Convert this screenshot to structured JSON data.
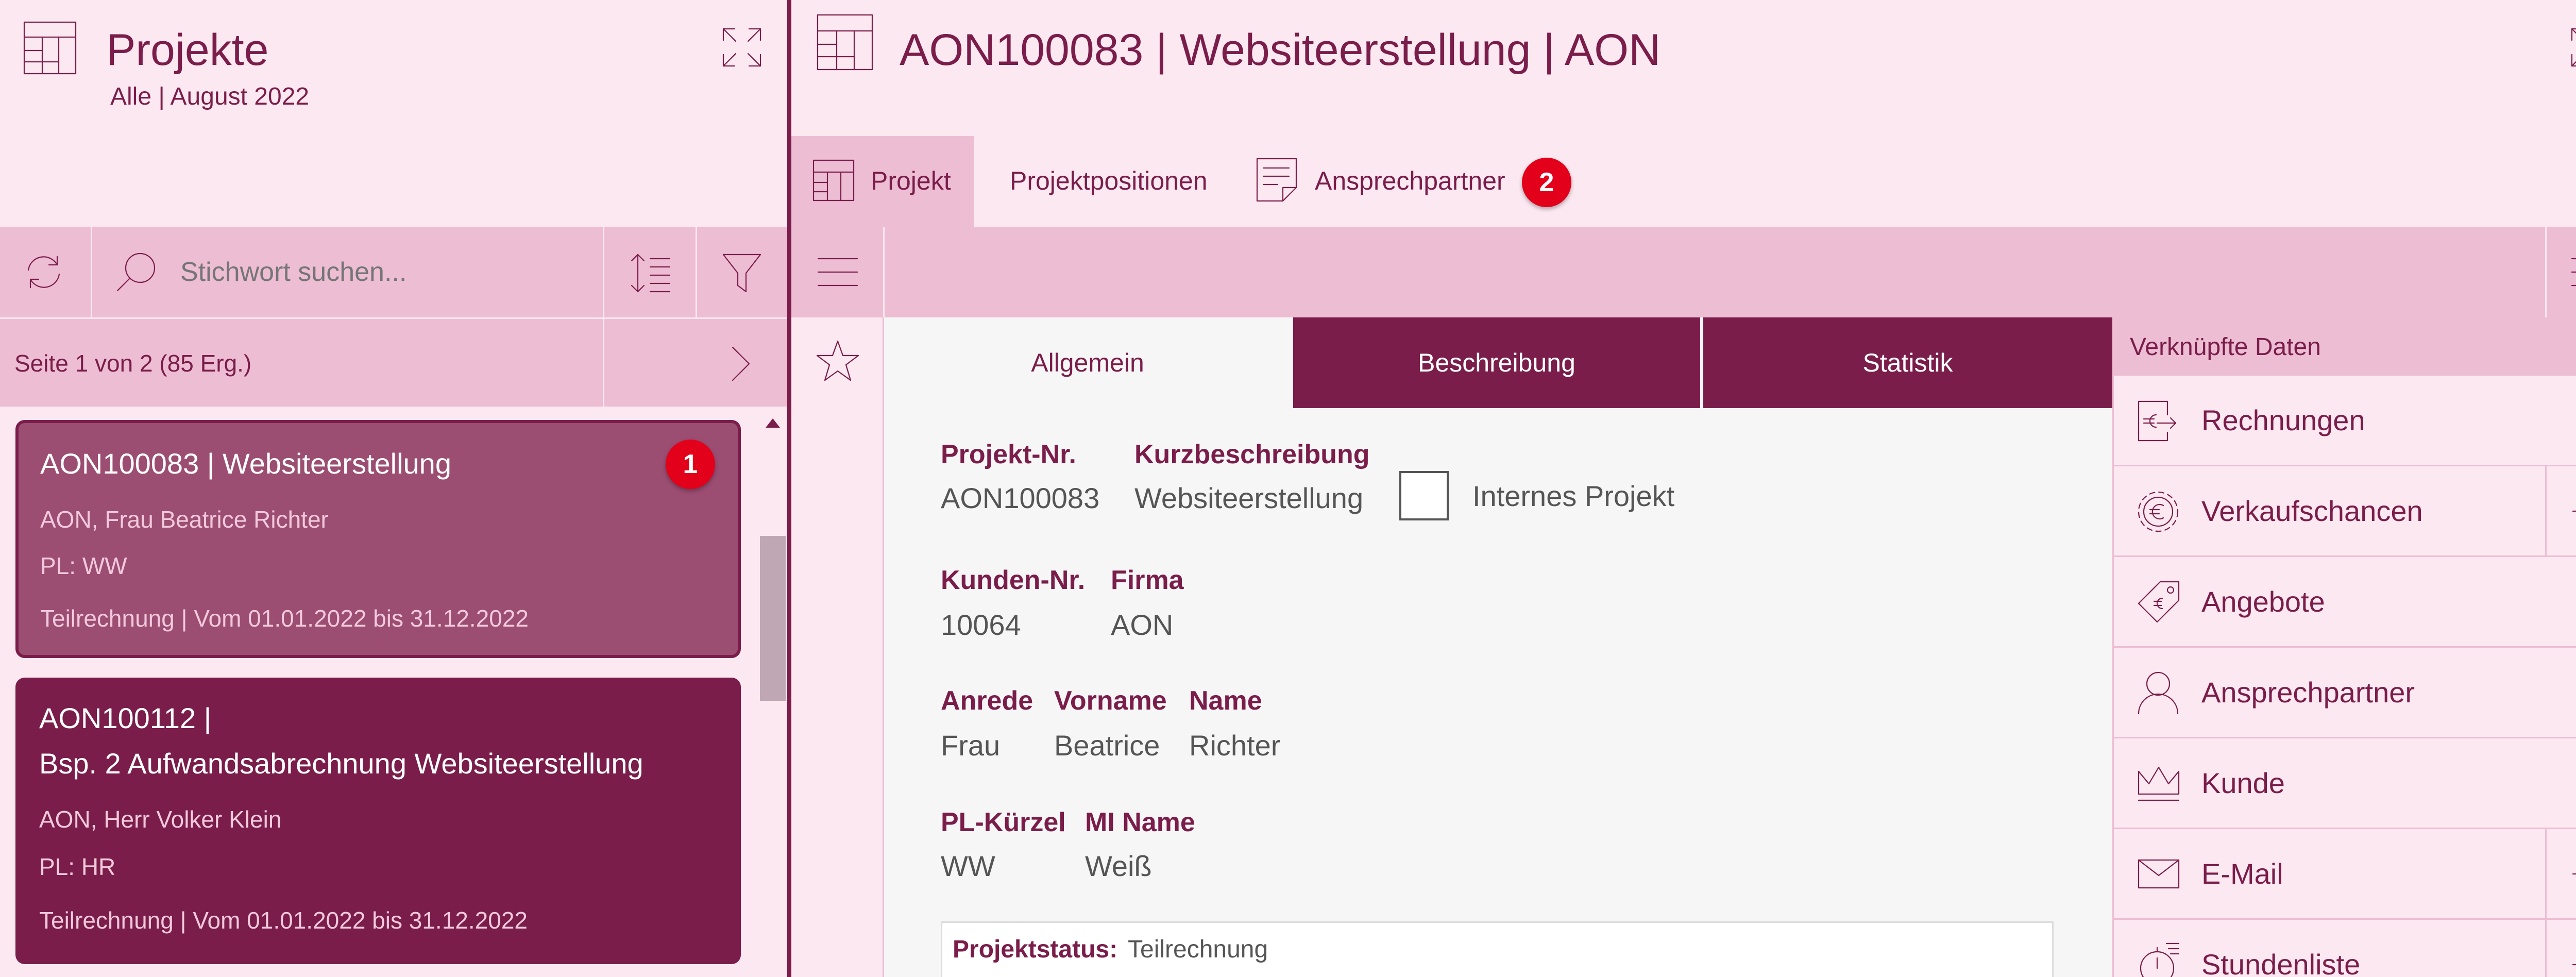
{
  "left_panel": {
    "title": "Projekte",
    "subtitle": "Alle | August 2022",
    "search_placeholder": "Stichwort suchen...",
    "page_info": "Seite 1 von 2 (85 Erg.)",
    "cards": [
      {
        "title": "AON100083 | Websiteerstellung",
        "line1": "AON,  Frau Beatrice Richter",
        "line2": "PL: WW",
        "line3": "Teilrechnung | Vom 01.01.2022 bis 31.12.2022",
        "badge": "1"
      },
      {
        "title_a": "AON100112 |",
        "title_b": "Bsp. 2 Aufwandsabrechnung Websiteerstellung",
        "line1": "AON,  Herr Volker Klein",
        "line2": "PL: HR",
        "line3": "Teilrechnung | Vom 01.01.2022 bis 31.12.2022"
      }
    ]
  },
  "detail": {
    "title": "AON100083 | Websiteerstellung | AON",
    "tabs": [
      {
        "label": "Projekt"
      },
      {
        "label": "Projektpositionen"
      },
      {
        "label": "Ansprechpartner",
        "badge": "2"
      }
    ],
    "subtabs": [
      "Allgemein",
      "Beschreibung",
      "Statistik"
    ],
    "form": {
      "projekt_nr_label": "Projekt-Nr.",
      "projekt_nr": "AON100083",
      "kurzbeschreibung_label": "Kurzbeschreibung",
      "kurzbeschreibung": "Websiteerstellung",
      "internes_projekt_label": "Internes Projekt",
      "internes_projekt_checked": false,
      "kunden_nr_label": "Kunden-Nr.",
      "kunden_nr": "10064",
      "firma_label": "Firma",
      "firma": "AON",
      "anrede_label": "Anrede",
      "anrede": "Frau",
      "vorname_label": "Vorname",
      "vorname": "Beatrice",
      "name_label": "Name",
      "name": "Richter",
      "pl_kuerzel_label": "PL-Kürzel",
      "pl_kuerzel": "WW",
      "mi_name_label": "MI Name",
      "mi_name": "Weiß",
      "projektstatus_label": "Projektstatus:",
      "projektstatus": "Teilrechnung"
    },
    "linked": {
      "header": "Verknüpfte Daten",
      "items": [
        {
          "label": "Rechnungen",
          "icon": "invoice-icon",
          "plus": false
        },
        {
          "label": "Verkaufschancen",
          "icon": "euro-gear-icon",
          "plus": true
        },
        {
          "label": "Angebote",
          "icon": "euro-tag-icon",
          "plus": false
        },
        {
          "label": "Ansprechpartner",
          "icon": "person-icon",
          "plus": false
        },
        {
          "label": "Kunde",
          "icon": "crown-icon",
          "plus": false
        },
        {
          "label": "E-Mail",
          "icon": "mail-icon",
          "plus": true
        },
        {
          "label": "Stundenliste",
          "icon": "stopwatch-icon",
          "plus": true
        }
      ]
    }
  },
  "colors": {
    "primary": "#7a1d4a",
    "light_bg": "#fce8f1",
    "toolbar": "#edbdd3",
    "badge": "#e3001b",
    "selected_card": "#9c4d72"
  }
}
